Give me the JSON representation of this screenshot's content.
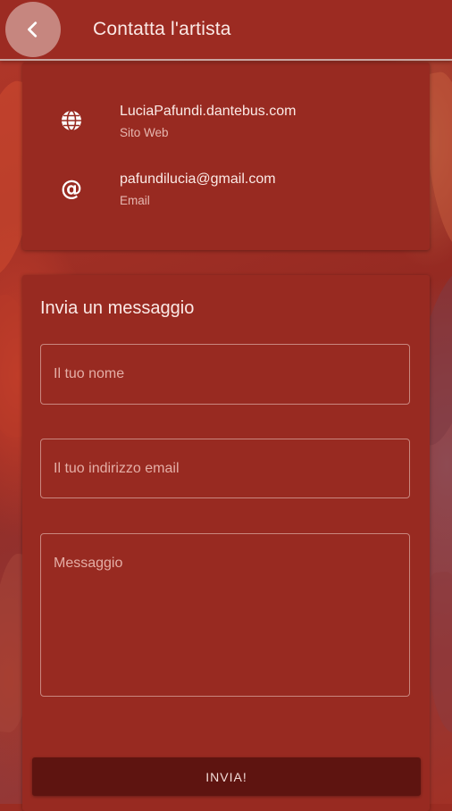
{
  "header": {
    "title": "Contatta l'artista",
    "back_icon": "chevron-left-icon"
  },
  "contact": {
    "website": {
      "value": "LuciaPafundi.dantebus.com",
      "label": "Sito Web",
      "icon": "globe-icon"
    },
    "email": {
      "value": "pafundilucia@gmail.com",
      "label": "Email",
      "icon": "at-icon"
    }
  },
  "form": {
    "heading": "Invia un messaggio",
    "name_placeholder": "Il tuo nome",
    "email_placeholder": "Il tuo indirizzo email",
    "message_placeholder": "Messaggio",
    "submit_label": "INVIA!"
  },
  "colors": {
    "primary": "#9c2b22",
    "button": "#5e1410",
    "text": "#fbe9e6"
  }
}
